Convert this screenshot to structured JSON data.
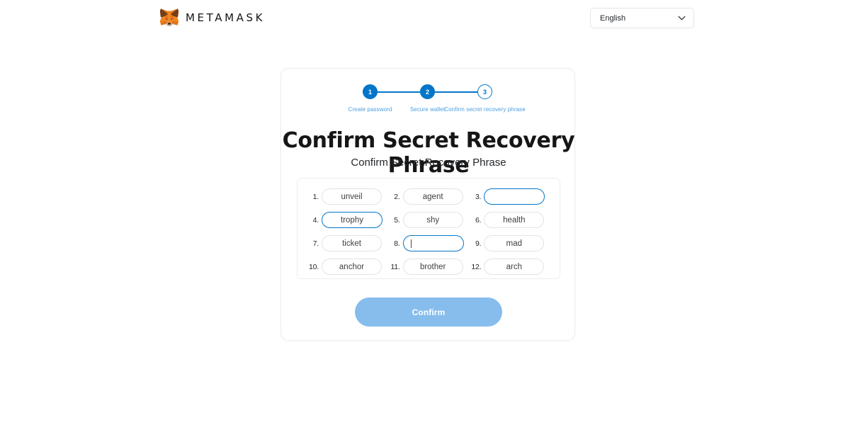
{
  "header": {
    "brand_name": "METAMASK",
    "fox_icon": "metamask-fox-icon",
    "language": {
      "selected": "English",
      "chevron_icon": "chevron-down-icon"
    }
  },
  "stepper": {
    "steps": [
      {
        "number": "1",
        "label": "Create password",
        "state": "complete"
      },
      {
        "number": "2",
        "label": "Secure wallet",
        "state": "complete"
      },
      {
        "number": "3",
        "label": "Confirm secret recovery phrase",
        "state": "current"
      }
    ]
  },
  "main": {
    "title": "Confirm Secret Recovery Phrase",
    "subtitle": "Confirm Secret Recovery Phrase"
  },
  "seed_grid": {
    "words": [
      {
        "index": "1.",
        "value": "unveil",
        "state": "filled"
      },
      {
        "index": "2.",
        "value": "agent",
        "state": "filled"
      },
      {
        "index": "3.",
        "value": "",
        "state": "active"
      },
      {
        "index": "4.",
        "value": "trophy",
        "state": "active-filled"
      },
      {
        "index": "5.",
        "value": "shy",
        "state": "filled"
      },
      {
        "index": "6.",
        "value": "health",
        "state": "filled"
      },
      {
        "index": "7.",
        "value": "ticket",
        "state": "filled"
      },
      {
        "index": "8.",
        "value": "",
        "state": "focused"
      },
      {
        "index": "9.",
        "value": "mad",
        "state": "filled"
      },
      {
        "index": "10.",
        "value": "anchor",
        "state": "filled"
      },
      {
        "index": "11.",
        "value": "brother",
        "state": "filled"
      },
      {
        "index": "12.",
        "value": "arch",
        "state": "filled"
      }
    ]
  },
  "footer": {
    "confirm_label": "Confirm"
  },
  "colors": {
    "accent_blue": "#0376c9",
    "step_label_blue": "#4a9ee0",
    "button_disabled_blue": "#86bded",
    "text_dark": "#161616",
    "border_light": "#ededed"
  }
}
